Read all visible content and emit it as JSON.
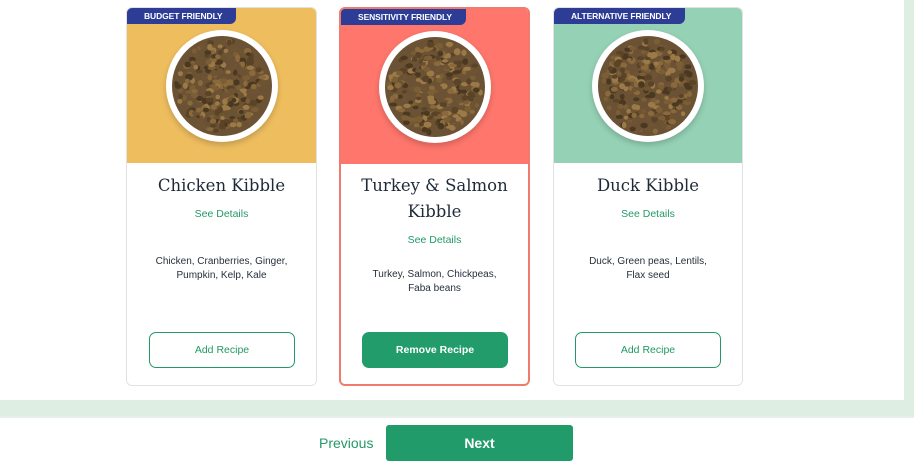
{
  "recipes": [
    {
      "badge": "BUDGET FRIENDLY",
      "name": "Chicken Kibble",
      "details_link": "See Details",
      "ingredients": "Chicken, Cranberries, Ginger, Pumpkin, Kelp, Kale",
      "button_label": "Add Recipe",
      "selected": false,
      "image_bg": "#eebd5e",
      "image_icon": "kibble-bowl-image"
    },
    {
      "badge": "SENSITIVITY FRIENDLY",
      "name": "Turkey & Salmon Kibble",
      "details_link": "See Details",
      "ingredients": "Turkey, Salmon, Chickpeas, Faba beans",
      "button_label": "Remove Recipe",
      "selected": true,
      "image_bg": "#fe766c",
      "image_icon": "kibble-bowl-image"
    },
    {
      "badge": "ALTERNATIVE FRIENDLY",
      "name": "Duck Kibble",
      "details_link": "See Details",
      "ingredients": "Duck, Green peas, Lentils, Flax seed",
      "button_label": "Add Recipe",
      "selected": false,
      "image_bg": "#95d1b5",
      "image_icon": "kibble-bowl-image"
    }
  ],
  "navigation": {
    "previous_label": "Previous",
    "next_label": "Next"
  },
  "colors": {
    "brand_green": "#229966",
    "badge_navy": "#2d3d95",
    "selected_border": "#f07a6d",
    "footer_band": "#dfeee3"
  }
}
